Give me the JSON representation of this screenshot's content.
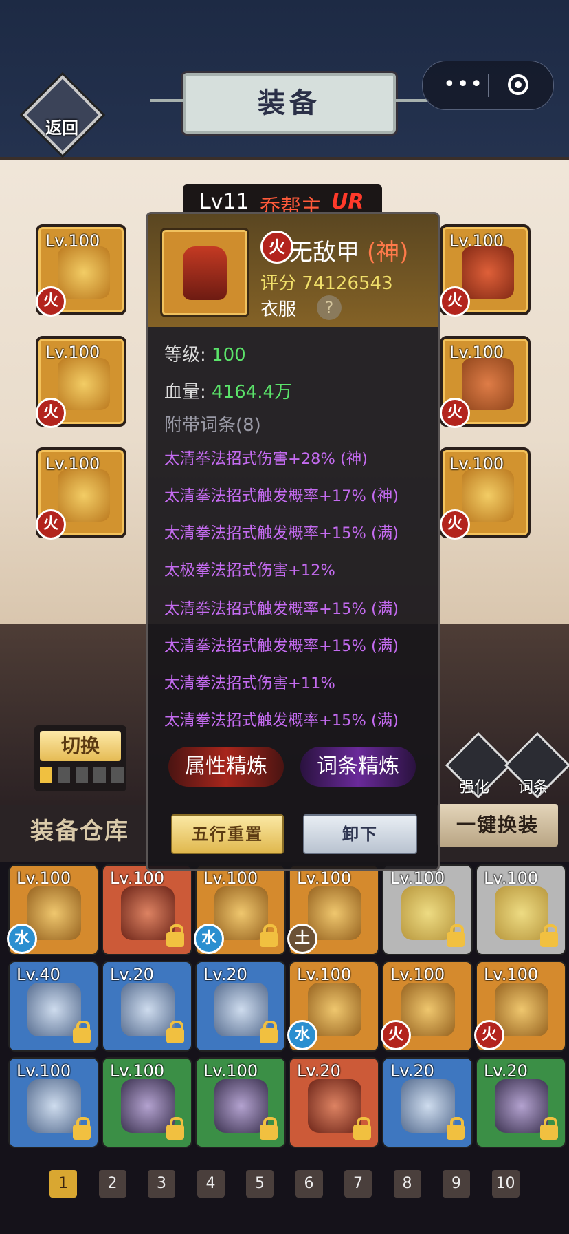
{
  "header": {
    "title": "装备",
    "back_label": "返回",
    "menu_dots": "•••"
  },
  "character": {
    "level": "Lv11",
    "name": "乔帮主",
    "rarity": "UR"
  },
  "equipped_left": [
    {
      "level": "Lv.100",
      "element": "火"
    },
    {
      "level": "Lv.100",
      "element": "火"
    },
    {
      "level": "Lv.100",
      "element": "火"
    }
  ],
  "equipped_right": [
    {
      "level": "Lv.100",
      "element": "火"
    },
    {
      "level": "Lv.100",
      "element": "火"
    },
    {
      "level": "Lv.100",
      "element": "火"
    }
  ],
  "popup": {
    "element": "火",
    "name": "无敌甲",
    "quality": "(神)",
    "score_label": "评分",
    "score_value": "74126543",
    "slot_type": "衣服",
    "help": "?",
    "level_label": "等级:",
    "level_value": "100",
    "hp_label": "血量:",
    "hp_value": "4164.4万",
    "affix_header": "附带词条(8)",
    "affixes": [
      "太清拳法招式伤害+28% (神)",
      "太清拳法招式触发概率+17% (神)",
      "太清拳法招式触发概率+15% (满)",
      "太极拳法招式伤害+12%",
      "太清拳法招式触发概率+15% (满)",
      "太清拳法招式触发概率+15% (满)",
      "太清拳法招式伤害+11%",
      "太清拳法招式触发概率+15% (满)"
    ],
    "refine_attr": "属性精炼",
    "refine_affix": "词条精炼",
    "reset_label": "五行重置",
    "unequip_label": "卸下"
  },
  "panel": {
    "switch_label": "切换",
    "strengthen_label": "强化",
    "affix_tool_label": "词条"
  },
  "warehouse": {
    "title": "装备仓库",
    "one_key_label": "一键换装",
    "items": [
      {
        "level": "Lv.100",
        "rarity": "orange",
        "element": "水",
        "locked": false
      },
      {
        "level": "Lv.100",
        "rarity": "red",
        "element": "",
        "locked": true
      },
      {
        "level": "Lv.100",
        "rarity": "orange",
        "element": "水",
        "locked": true
      },
      {
        "level": "Lv.100",
        "rarity": "orange",
        "element": "土",
        "locked": false
      },
      {
        "level": "Lv.100",
        "rarity": "gray",
        "element": "",
        "locked": true
      },
      {
        "level": "Lv.100",
        "rarity": "gray",
        "element": "",
        "locked": true
      },
      {
        "level": "Lv.40",
        "rarity": "blue",
        "element": "",
        "locked": true
      },
      {
        "level": "Lv.20",
        "rarity": "blue",
        "element": "",
        "locked": true
      },
      {
        "level": "Lv.20",
        "rarity": "blue",
        "element": "",
        "locked": true
      },
      {
        "level": "Lv.100",
        "rarity": "orange",
        "element": "水",
        "locked": false
      },
      {
        "level": "Lv.100",
        "rarity": "orange",
        "element": "火",
        "locked": false
      },
      {
        "level": "Lv.100",
        "rarity": "orange",
        "element": "火",
        "locked": false
      },
      {
        "level": "Lv.100",
        "rarity": "blue",
        "element": "",
        "locked": true
      },
      {
        "level": "Lv.100",
        "rarity": "green",
        "element": "",
        "locked": true
      },
      {
        "level": "Lv.100",
        "rarity": "green",
        "element": "",
        "locked": true
      },
      {
        "level": "Lv.20",
        "rarity": "red",
        "element": "",
        "locked": true
      },
      {
        "level": "Lv.20",
        "rarity": "blue",
        "element": "",
        "locked": true
      },
      {
        "level": "Lv.20",
        "rarity": "green",
        "element": "",
        "locked": true
      }
    ]
  },
  "pagination": {
    "pages": [
      "1",
      "2",
      "3",
      "4",
      "5",
      "6",
      "7",
      "8",
      "9",
      "10"
    ],
    "active": 0
  }
}
